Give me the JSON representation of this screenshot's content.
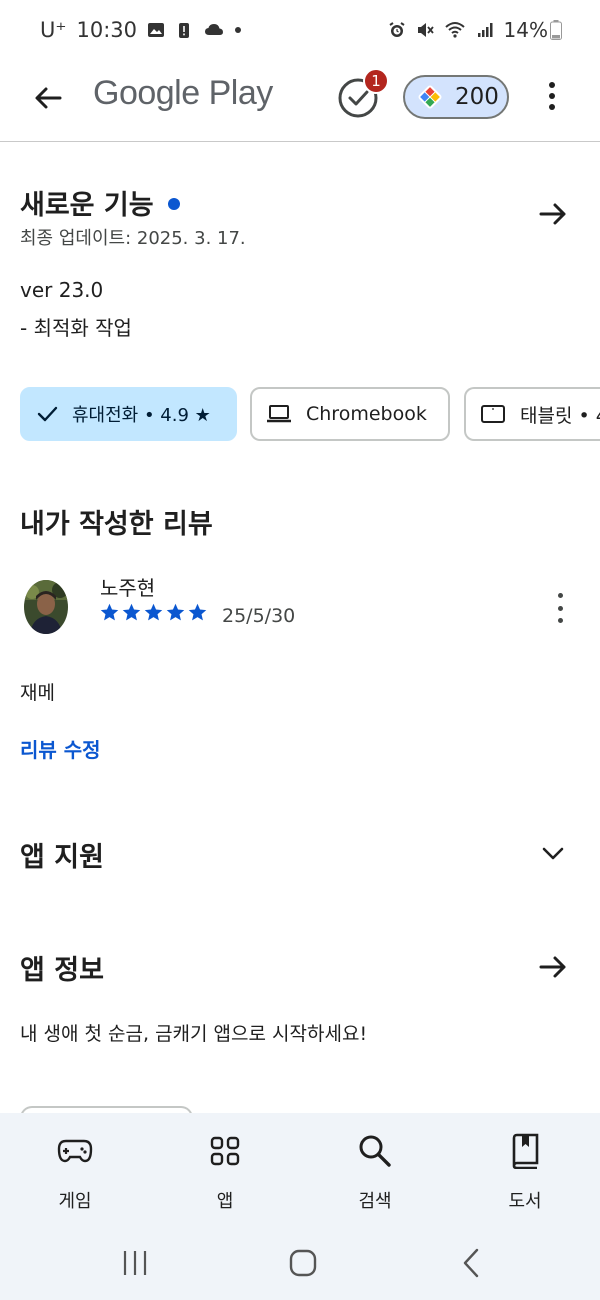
{
  "status_bar": {
    "carrier": "U⁺",
    "time": "10:30",
    "battery": "14%"
  },
  "app_bar": {
    "title": "Google Play",
    "tasks_badge": "1",
    "points": "200"
  },
  "whats_new": {
    "title": "새로운 기능",
    "updated": "최종 업데이트: 2025. 3. 17.",
    "version": "ver 23.0",
    "notes": "- 최적화 작업"
  },
  "device_chips": [
    {
      "label": "휴대전화 • 4.9 ★",
      "selected": true,
      "icon": "check-icon"
    },
    {
      "label": "Chromebook",
      "selected": false,
      "icon": "laptop-icon"
    },
    {
      "label": "태블릿 • 4",
      "selected": false,
      "icon": "tablet-icon"
    }
  ],
  "my_review": {
    "title": "내가 작성한 리뷰",
    "reviewer": "노주현",
    "rating": 5,
    "date": "25/5/30",
    "text": "재메",
    "edit_label": "리뷰 수정"
  },
  "app_support": {
    "title": "앱 지원"
  },
  "app_info": {
    "title": "앱 정보",
    "description": "내 생애 첫 순금, 금캐기 앱으로 시작하세요!"
  },
  "bottom_nav": [
    {
      "label": "게임",
      "icon": "gamepad-icon"
    },
    {
      "label": "앱",
      "icon": "apps-grid-icon"
    },
    {
      "label": "검색",
      "icon": "search-icon"
    },
    {
      "label": "도서",
      "icon": "book-icon"
    }
  ],
  "colors": {
    "accent": "#0b57d0",
    "chip_selected": "#c2e7ff",
    "badge": "#b3261e",
    "points_pill": "#d3e3fd",
    "nav_background": "#f0f4f9"
  }
}
